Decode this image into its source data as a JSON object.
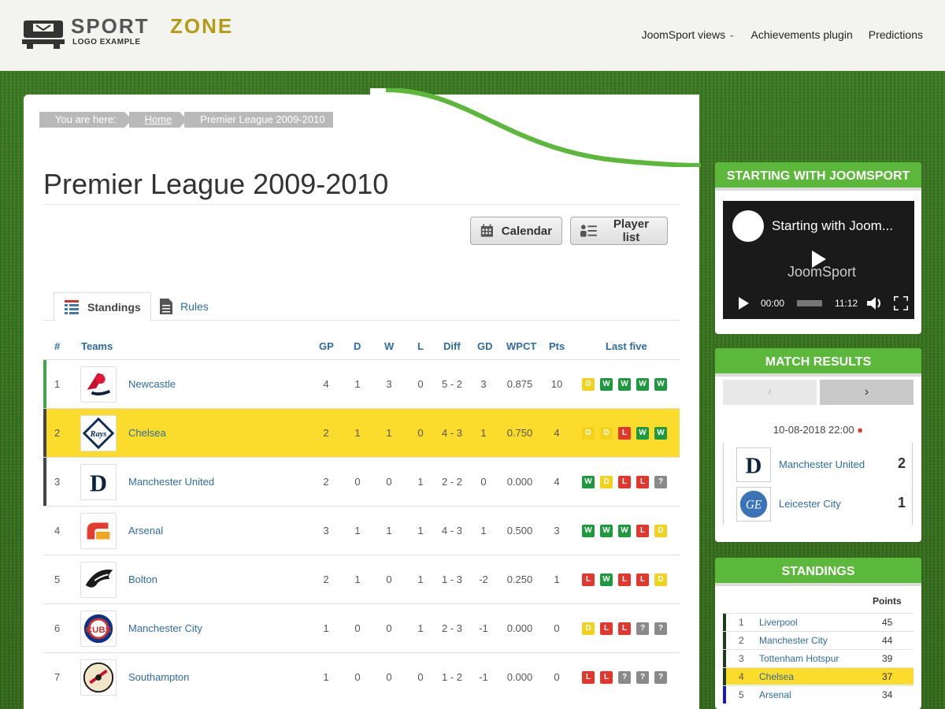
{
  "site": {
    "logo_word1": "SPORT",
    "logo_word2": "ZONE",
    "logo_sub": "LOGO EXAMPLE",
    "nav": [
      "JoomSport views",
      "Achievements plugin",
      "Predictions"
    ]
  },
  "breadcrumb": {
    "prefix": "You are here:",
    "home": "Home",
    "current": "Premier League 2009-2010"
  },
  "page": {
    "title": "Premier League 2009-2010",
    "calendar_label": "Calendar",
    "playerlist_label": "Player list"
  },
  "tabs": {
    "standings": "Standings",
    "rules": "Rules"
  },
  "table": {
    "headers": {
      "rank": "#",
      "teams": "Teams",
      "gp": "GP",
      "d": "D",
      "w": "W",
      "l": "L",
      "diff": "Diff",
      "gd": "GD",
      "wpct": "WPCT",
      "pts": "Pts",
      "last5": "Last five"
    },
    "rows": [
      {
        "rank": "1",
        "team": "Newcastle",
        "gp": "4",
        "d": "1",
        "w": "3",
        "l": "0",
        "diff": "5 - 2",
        "gd": "3",
        "wpct": "0.875",
        "pts": "10",
        "last5": [
          "D",
          "W",
          "W",
          "W",
          "W"
        ],
        "bar": "#3aa845",
        "highlight": false
      },
      {
        "rank": "2",
        "team": "Chelsea",
        "gp": "2",
        "d": "1",
        "w": "1",
        "l": "0",
        "diff": "4 - 3",
        "gd": "1",
        "wpct": "0.750",
        "pts": "4",
        "last5": [
          "D",
          "D",
          "L",
          "W",
          "W"
        ],
        "bar": "#444444",
        "highlight": true
      },
      {
        "rank": "3",
        "team": "Manchester United",
        "gp": "2",
        "d": "0",
        "w": "0",
        "l": "1",
        "diff": "2 - 2",
        "gd": "0",
        "wpct": "0.000",
        "pts": "4",
        "last5": [
          "W",
          "D",
          "L",
          "L",
          "?"
        ],
        "bar": "#444444",
        "highlight": false
      },
      {
        "rank": "4",
        "team": "Arsenal",
        "gp": "3",
        "d": "1",
        "w": "1",
        "l": "1",
        "diff": "4 - 3",
        "gd": "1",
        "wpct": "0.500",
        "pts": "3",
        "last5": [
          "W",
          "W",
          "W",
          "L",
          "D"
        ],
        "bar": "",
        "highlight": false
      },
      {
        "rank": "5",
        "team": "Bolton",
        "gp": "2",
        "d": "1",
        "w": "0",
        "l": "1",
        "diff": "1 - 3",
        "gd": "-2",
        "wpct": "0.250",
        "pts": "1",
        "last5": [
          "L",
          "W",
          "L",
          "L",
          "D"
        ],
        "bar": "",
        "highlight": false
      },
      {
        "rank": "6",
        "team": "Manchester City",
        "gp": "1",
        "d": "0",
        "w": "0",
        "l": "1",
        "diff": "2 - 3",
        "gd": "-1",
        "wpct": "0.000",
        "pts": "0",
        "last5": [
          "D",
          "L",
          "L",
          "?",
          "?"
        ],
        "bar": "",
        "highlight": false
      },
      {
        "rank": "7",
        "team": "Southampton",
        "gp": "1",
        "d": "0",
        "w": "0",
        "l": "0",
        "diff": "1 - 2",
        "gd": "-1",
        "wpct": "0.000",
        "pts": "0",
        "last5": [
          "L",
          "L",
          "?",
          "?",
          "?"
        ],
        "bar": "",
        "highlight": false
      }
    ]
  },
  "badge_colors": {
    "W": "#1e9a3e",
    "D": "#f2d21b",
    "L": "#e2372d",
    "?": "#8a8a8a"
  },
  "widgets": {
    "video": {
      "title": "STARTING WITH JOOMSPORT",
      "video_title": "Starting with Joom...",
      "center_text": "JoomSport",
      "time_current": "00:00",
      "time_total": "11:12"
    },
    "match": {
      "title": "MATCH RESULTS",
      "date": "10-08-2018 22:00",
      "home": "Manchester United",
      "home_score": "2",
      "away": "Leicester City",
      "away_score": "1"
    },
    "standings": {
      "title": "STANDINGS",
      "points_label": "Points",
      "rows": [
        {
          "rank": "1",
          "team": "Liverpool",
          "pts": "45",
          "bar": "#1f3d1a",
          "highlight": false
        },
        {
          "rank": "2",
          "team": "Manchester City",
          "pts": "44",
          "bar": "#1f3d1a",
          "highlight": false
        },
        {
          "rank": "3",
          "team": "Tottenham Hotspur",
          "pts": "39",
          "bar": "#1f3d1a",
          "highlight": false
        },
        {
          "rank": "4",
          "team": "Chelsea",
          "pts": "37",
          "bar": "#1f3d1a",
          "highlight": true
        },
        {
          "rank": "5",
          "team": "Arsenal",
          "pts": "34",
          "bar": "#1a1ab0",
          "highlight": false
        }
      ]
    }
  },
  "colors": {
    "accent_green": "#5bb83a",
    "link_blue": "#2d6ca2",
    "highlight_yellow": "#fbdb2c"
  }
}
